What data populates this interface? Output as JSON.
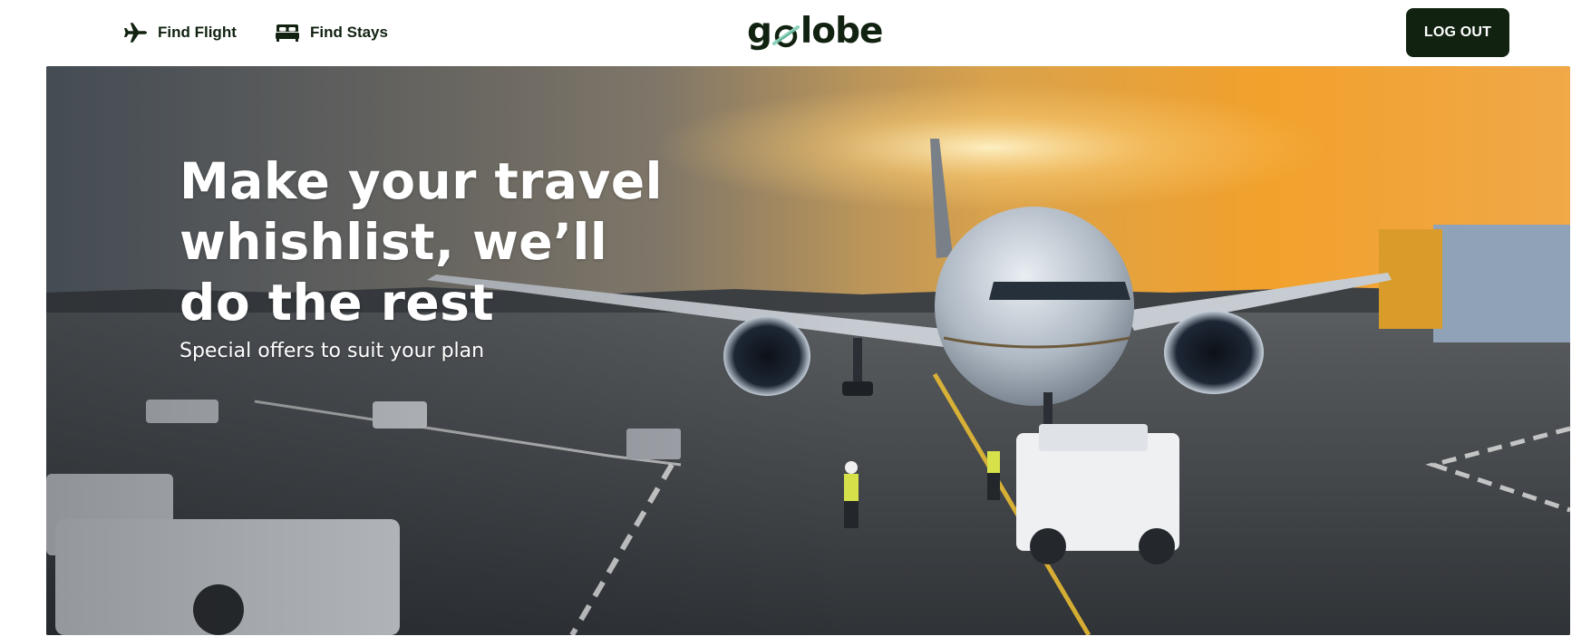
{
  "header": {
    "nav": {
      "find_flight": {
        "label": "Find Flight",
        "icon": "airplane-icon"
      },
      "find_stays": {
        "label": "Find Stays",
        "icon": "bed-icon"
      }
    },
    "logo": {
      "text_before": "g",
      "text_after": "lobe",
      "icon": "globe-icon"
    },
    "logout_label": "LOG OUT"
  },
  "hero": {
    "title": "Make your travel whishlist, we’ll do the rest",
    "subtitle": "Special offers to suit your plan",
    "image": "airport-sunset-airplane-photo"
  },
  "colors": {
    "brand_dark": "#112211",
    "brand_accent": "#8DD3BB",
    "white": "#ffffff"
  }
}
